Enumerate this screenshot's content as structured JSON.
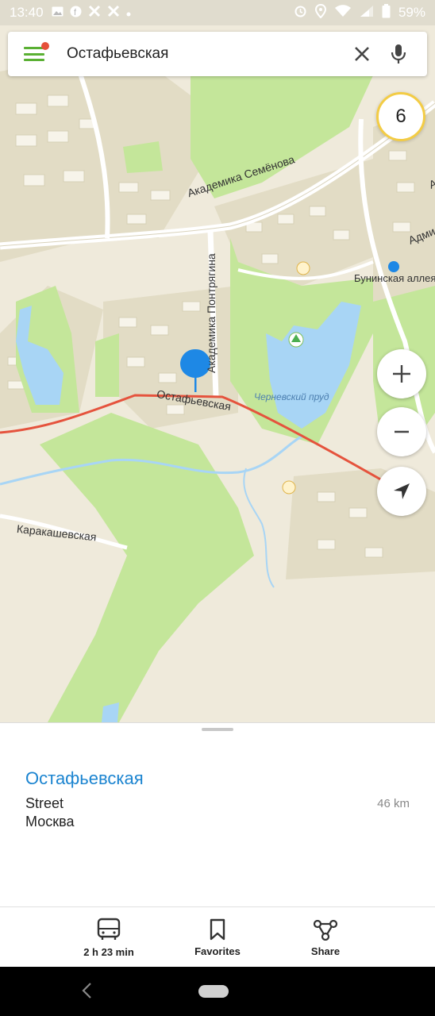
{
  "status_bar": {
    "time": "13:40",
    "battery": "59%",
    "notification_icons": [
      "gallery-icon",
      "facebook-icon",
      "x-icon",
      "x-icon",
      "dot-icon"
    ],
    "system_icons": [
      "alarm-icon",
      "location-icon",
      "wifi-icon",
      "signal-icon",
      "battery-icon"
    ]
  },
  "search": {
    "query": "Остафьевская"
  },
  "map": {
    "layers_count": "6",
    "labels": {
      "street_semenova": "Академика Семёнова",
      "street_pontryagina": "Академика Понтрягина",
      "street_ostafevskaya": "Остафьевская",
      "pond": "Черневский пруд",
      "metro": "Бунинская аллея",
      "street_karakashevskaya": "Каракашевская",
      "street_admi": "Адми",
      "street_a": "А"
    },
    "colors": {
      "park": "#c4e69a",
      "water": "#a8d5f5",
      "route": "#e5533d",
      "pin": "#1e88e5"
    }
  },
  "place": {
    "name": "Остафьевская",
    "type": "Street",
    "city": "Москва",
    "distance": "46 km"
  },
  "actions": [
    {
      "label": "2 h 23 min",
      "icon": "bus-icon"
    },
    {
      "label": "Favorites",
      "icon": "bookmark-icon"
    },
    {
      "label": "Share",
      "icon": "share-icon"
    }
  ]
}
